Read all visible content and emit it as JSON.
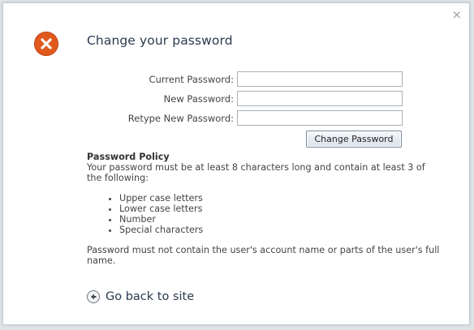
{
  "dialog": {
    "close_glyph": "×",
    "icon": "error-x-icon",
    "title": "Change your password"
  },
  "form": {
    "current_password_label": "Current Password:",
    "new_password_label": "New Password:",
    "retype_password_label": "Retype New Password:",
    "current_password_value": "",
    "new_password_value": "",
    "retype_password_value": "",
    "submit_label": "Change Password"
  },
  "policy": {
    "title": "Password Policy",
    "intro": "Your password must be at least 8 characters long and contain at least 3 of the following:",
    "items": [
      "Upper case letters",
      "Lower case letters",
      "Number",
      "Special characters"
    ],
    "note": "Password must not contain the user's account name or parts of the user's full name."
  },
  "back": {
    "icon": "back-arrow-icon",
    "label": "Go back to site"
  },
  "colors": {
    "error_icon": "#e05a1e",
    "title_text": "#2a3a4f"
  }
}
